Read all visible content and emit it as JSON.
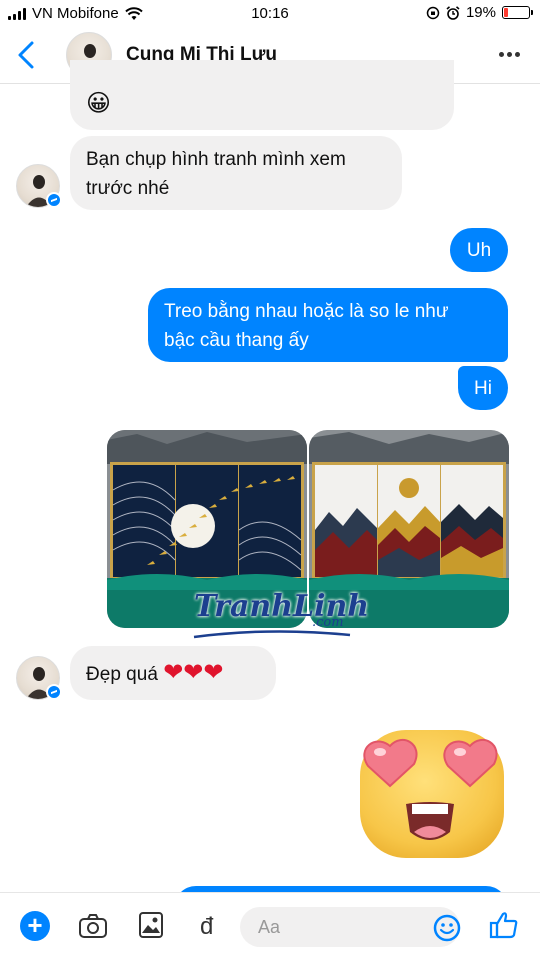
{
  "status_bar": {
    "carrier": "VN Mobifone",
    "time": "10:16",
    "battery_percent": "19%",
    "battery_level": 0.19
  },
  "header": {
    "contact_name": "Cung Mi Thị Lưu",
    "back_icon": "chevron-left-icon",
    "more_icon": "more-horizontal-icon"
  },
  "messages": [
    {
      "from": "them",
      "type": "emoji",
      "text": "😀"
    },
    {
      "from": "them",
      "type": "text",
      "lines": [
        "Bạn chụp hình tranh mình xem",
        "trước nhé"
      ]
    },
    {
      "from": "me",
      "type": "text",
      "lines": [
        "Uh"
      ]
    },
    {
      "from": "me",
      "type": "text",
      "lines": [
        "Treo bằng nhau hoặc là so le như",
        "bậc cầu thang ấy"
      ]
    },
    {
      "from": "me",
      "type": "text",
      "lines": [
        "Hi"
      ]
    },
    {
      "from": "me",
      "type": "photos",
      "count": 2
    },
    {
      "from": "them",
      "type": "text",
      "lines": [
        "Đẹp quá ❤❤❤"
      ]
    },
    {
      "from": "them",
      "type": "sticker",
      "icon": "heart-eyes-emoji-sticker"
    }
  ],
  "watermark": {
    "brand": "TranhLinh",
    "domain": ".com"
  },
  "composer": {
    "placeholder": "Aa",
    "currency_symbol": "đ",
    "icons": [
      "plus-icon",
      "camera-icon",
      "image-icon",
      "payment-icon",
      "emoji-icon",
      "thumbs-up-icon"
    ]
  },
  "colors": {
    "accent": "#0084ff",
    "incoming_bubble": "#f1f0f0",
    "heart": "#e0142d"
  }
}
